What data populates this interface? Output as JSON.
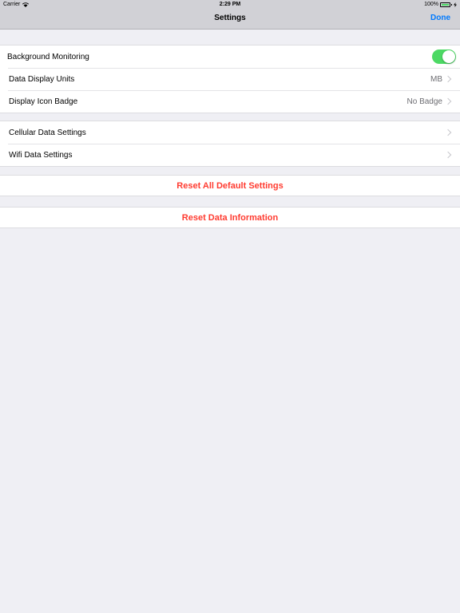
{
  "status_bar": {
    "carrier": "Carrier",
    "time": "2:29 PM",
    "battery": "100%",
    "wifi_icon": "wifi-icon",
    "battery_icon": "battery-icon",
    "charging_icon": "bolt-icon"
  },
  "nav": {
    "title": "Settings",
    "done_label": "Done"
  },
  "section1": {
    "rows": [
      {
        "label": "Background Monitoring",
        "control": "toggle",
        "on": true
      },
      {
        "label": "Data Display Units",
        "value": "MB"
      },
      {
        "label": "Display Icon Badge",
        "value": "No Badge"
      }
    ]
  },
  "section2": {
    "rows": [
      {
        "label": "Cellular Data Settings"
      },
      {
        "label": "Wifi Data Settings"
      }
    ]
  },
  "actions": {
    "reset_defaults": "Reset All Default Settings",
    "reset_data": "Reset Data Information"
  },
  "colors": {
    "accent": "#007aff",
    "destructive": "#ff3b30",
    "toggle_on": "#4cd964",
    "background": "#efeff4"
  }
}
